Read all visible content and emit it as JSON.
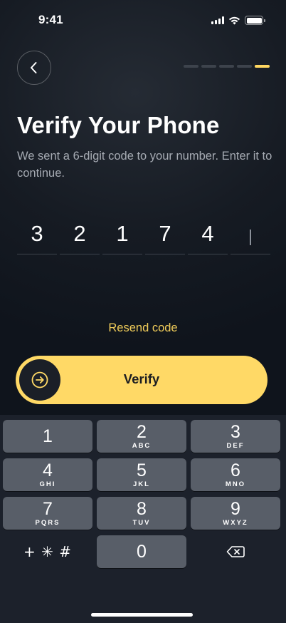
{
  "status_bar": {
    "time": "9:41"
  },
  "header": {
    "back_icon": "chevron-left-icon",
    "progress": {
      "total_steps": 5,
      "current_step": 5
    }
  },
  "content": {
    "title": "Verify Your Phone",
    "subtitle": "We sent a 6-digit code to your number. Enter it to continue.",
    "otp": [
      "3",
      "2",
      "1",
      "7",
      "4",
      ""
    ],
    "resend_label": "Resend code",
    "verify_label": "Verify",
    "verify_icon": "arrow-right-circle-icon"
  },
  "keypad": {
    "keys": [
      {
        "num": "1",
        "letters": ""
      },
      {
        "num": "2",
        "letters": "ABC"
      },
      {
        "num": "3",
        "letters": "DEF"
      },
      {
        "num": "4",
        "letters": "GHI"
      },
      {
        "num": "5",
        "letters": "JKL"
      },
      {
        "num": "6",
        "letters": "MNO"
      },
      {
        "num": "7",
        "letters": "PQRS"
      },
      {
        "num": "8",
        "letters": "TUV"
      },
      {
        "num": "9",
        "letters": "WXYZ"
      },
      {
        "num": "+ ✳ #",
        "letters": ""
      },
      {
        "num": "0",
        "letters": ""
      },
      {
        "num": "",
        "letters": "",
        "icon": "backspace-icon"
      }
    ]
  },
  "colors": {
    "accent": "#ffd966",
    "accent_text": "#f1cd5a",
    "background": "#0f141c",
    "key": "#585e68",
    "progress_inactive": "#3d434c"
  }
}
